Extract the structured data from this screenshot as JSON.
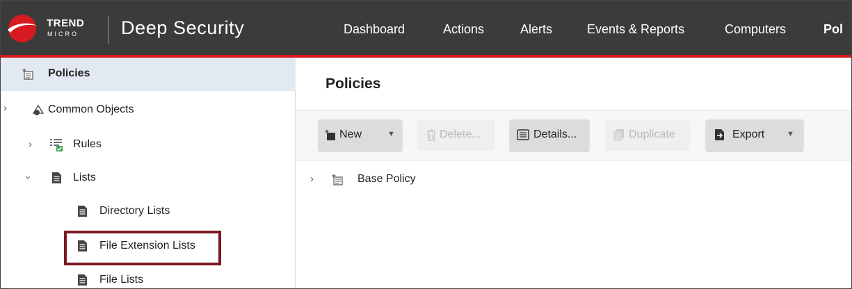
{
  "brand": {
    "vendor_top": "TREND",
    "vendor_bottom": "MICRO",
    "product": "Deep Security"
  },
  "nav": {
    "items": [
      {
        "label": "Dashboard"
      },
      {
        "label": "Actions"
      },
      {
        "label": "Alerts"
      },
      {
        "label": "Events & Reports"
      },
      {
        "label": "Computers"
      },
      {
        "label": "Pol"
      }
    ]
  },
  "sidebar": {
    "policies": "Policies",
    "common_objects": "Common Objects",
    "rules": "Rules",
    "lists": "Lists",
    "directory_lists": "Directory Lists",
    "file_extension_lists": "File Extension Lists",
    "file_lists": "File Lists"
  },
  "main": {
    "title": "Policies",
    "toolbar": {
      "new": "New",
      "delete": "Delete...",
      "details": "Details...",
      "duplicate": "Duplicate",
      "export": "Export"
    },
    "tree": {
      "base_policy": "Base Policy"
    }
  },
  "colors": {
    "topbar": "#3b3b3b",
    "accent_red": "#d71920",
    "selected_row": "#e3e9f3",
    "highlight_box": "#7b1a26"
  }
}
